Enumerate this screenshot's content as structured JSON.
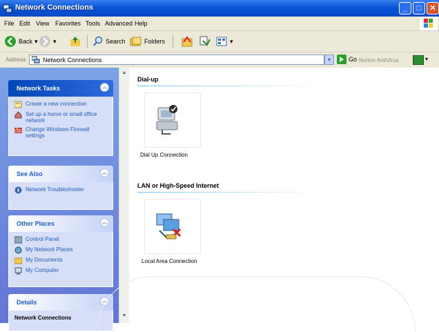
{
  "window": {
    "title": "Network Connections"
  },
  "menu": [
    "File",
    "Edit",
    "View",
    "Favorites",
    "Tools",
    "Advanced",
    "Help"
  ],
  "toolbar": {
    "back_label": "Back",
    "search_label": "Search",
    "folders_label": "Folders"
  },
  "address": {
    "label": "Address",
    "value": "Network Connections",
    "go_label": "Go",
    "norton_label": "Norton AntiVirus"
  },
  "sidebar": {
    "network_tasks": {
      "title": "Network Tasks",
      "items": [
        "Create a new connection",
        "Set up a home or small office network",
        "Change Windows Firewall settings"
      ]
    },
    "see_also": {
      "title": "See Also",
      "items": [
        "Network Troubleshooter"
      ]
    },
    "other_places": {
      "title": "Other Places",
      "items": [
        "Control Panel",
        "My Network Places",
        "My Documents",
        "My Computer"
      ]
    },
    "details": {
      "title": "Details",
      "items": [
        "Network Connections"
      ]
    }
  },
  "groups": [
    {
      "title": "Dial-up",
      "items": [
        {
          "label": "Dial Up Connection",
          "icon": "dialup-connection-icon"
        }
      ]
    },
    {
      "title": "LAN or High-Speed Internet",
      "items": [
        {
          "label": "Local Area Connection",
          "icon": "lan-connection-disconnected-icon"
        }
      ]
    }
  ],
  "colors": {
    "titlebar": "#0a55d8",
    "sidebar": "#6f8de0",
    "link": "#215dc6"
  }
}
